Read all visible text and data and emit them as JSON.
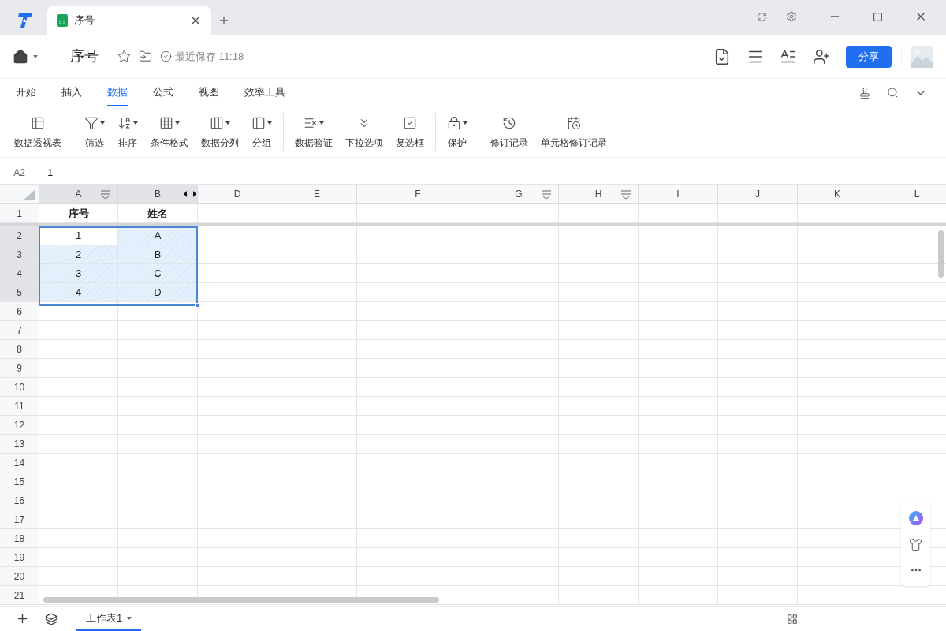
{
  "app_tab": {
    "title": "序号"
  },
  "doc": {
    "title": "序号",
    "save_status": "最近保存 11:18"
  },
  "share_button": "分享",
  "menu_tabs": [
    {
      "label": "开始",
      "selected": false
    },
    {
      "label": "插入",
      "selected": false
    },
    {
      "label": "数据",
      "selected": true
    },
    {
      "label": "公式",
      "selected": false
    },
    {
      "label": "视图",
      "selected": false
    },
    {
      "label": "效率工具",
      "selected": false
    }
  ],
  "ribbon": [
    [
      {
        "kind": "pivot",
        "label": "数据透视表",
        "dropdown": false
      }
    ],
    [
      {
        "kind": "filter",
        "label": "筛选",
        "dropdown": true
      },
      {
        "kind": "sort",
        "label": "排序",
        "dropdown": true
      },
      {
        "kind": "format",
        "label": "条件格式",
        "dropdown": true
      },
      {
        "kind": "split",
        "label": "数据分列",
        "dropdown": true
      },
      {
        "kind": "group",
        "label": "分组",
        "dropdown": true
      }
    ],
    [
      {
        "kind": "validate",
        "label": "数据验证",
        "dropdown": true
      },
      {
        "kind": "dropdown",
        "label": "下拉选项",
        "dropdown": false
      },
      {
        "kind": "checkbox",
        "label": "复选框",
        "dropdown": false
      }
    ],
    [
      {
        "kind": "lock",
        "label": "保护",
        "dropdown": true
      }
    ],
    [
      {
        "kind": "history",
        "label": "修订记录",
        "dropdown": false
      },
      {
        "kind": "cellhistory",
        "label": "单元格修订记录",
        "dropdown": false
      }
    ]
  ],
  "formula_bar": {
    "cell_ref": "A2",
    "value": "1"
  },
  "columns": [
    {
      "label": "A",
      "filter": true,
      "selected": true,
      "hidden_after": false
    },
    {
      "label": "B",
      "filter": false,
      "selected": true,
      "hidden_after": true
    },
    {
      "label": "D",
      "filter": false,
      "selected": false,
      "hidden_after": false
    },
    {
      "label": "E",
      "filter": false,
      "selected": false,
      "hidden_after": false
    },
    {
      "label": "F",
      "filter": false,
      "selected": false,
      "hidden_after": false
    },
    {
      "label": "G",
      "filter": true,
      "selected": false,
      "hidden_after": false
    },
    {
      "label": "H",
      "filter": true,
      "selected": false,
      "hidden_after": false
    },
    {
      "label": "I",
      "filter": false,
      "selected": false,
      "hidden_after": false
    },
    {
      "label": "J",
      "filter": false,
      "selected": false,
      "hidden_after": false
    },
    {
      "label": "K",
      "filter": false,
      "selected": false,
      "hidden_after": false
    },
    {
      "label": "L",
      "filter": false,
      "selected": false,
      "hidden_after": false
    }
  ],
  "rows": [
    {
      "number": "1",
      "kind": "header",
      "selected": false,
      "cells": [
        "序号",
        "姓名"
      ]
    },
    {
      "number": "2",
      "kind": "data",
      "selected": true,
      "cells": [
        "1",
        "A"
      ]
    },
    {
      "number": "3",
      "kind": "data",
      "selected": true,
      "cells": [
        "2",
        "B"
      ]
    },
    {
      "number": "4",
      "kind": "data",
      "selected": true,
      "cells": [
        "3",
        "C"
      ]
    },
    {
      "number": "5",
      "kind": "data",
      "selected": true,
      "cells": [
        "4",
        "D"
      ]
    },
    {
      "number": "6",
      "kind": "data",
      "selected": false,
      "cells": []
    },
    {
      "number": "7",
      "kind": "data",
      "selected": false,
      "cells": []
    },
    {
      "number": "8",
      "kind": "data",
      "selected": false,
      "cells": []
    },
    {
      "number": "9",
      "kind": "data",
      "selected": false,
      "cells": []
    },
    {
      "number": "10",
      "kind": "data",
      "selected": false,
      "cells": []
    },
    {
      "number": "11",
      "kind": "data",
      "selected": false,
      "cells": []
    },
    {
      "number": "12",
      "kind": "data",
      "selected": false,
      "cells": []
    },
    {
      "number": "13",
      "kind": "data",
      "selected": false,
      "cells": []
    },
    {
      "number": "14",
      "kind": "data",
      "selected": false,
      "cells": []
    },
    {
      "number": "15",
      "kind": "data",
      "selected": false,
      "cells": []
    },
    {
      "number": "16",
      "kind": "data",
      "selected": false,
      "cells": []
    },
    {
      "number": "17",
      "kind": "data",
      "selected": false,
      "cells": []
    },
    {
      "number": "18",
      "kind": "data",
      "selected": false,
      "cells": []
    },
    {
      "number": "19",
      "kind": "data",
      "selected": false,
      "cells": []
    },
    {
      "number": "20",
      "kind": "data",
      "selected": false,
      "cells": []
    },
    {
      "number": "21",
      "kind": "data",
      "selected": false,
      "cells": []
    }
  ],
  "sheet_tabs": [
    {
      "label": "工作表1",
      "selected": true
    }
  ]
}
